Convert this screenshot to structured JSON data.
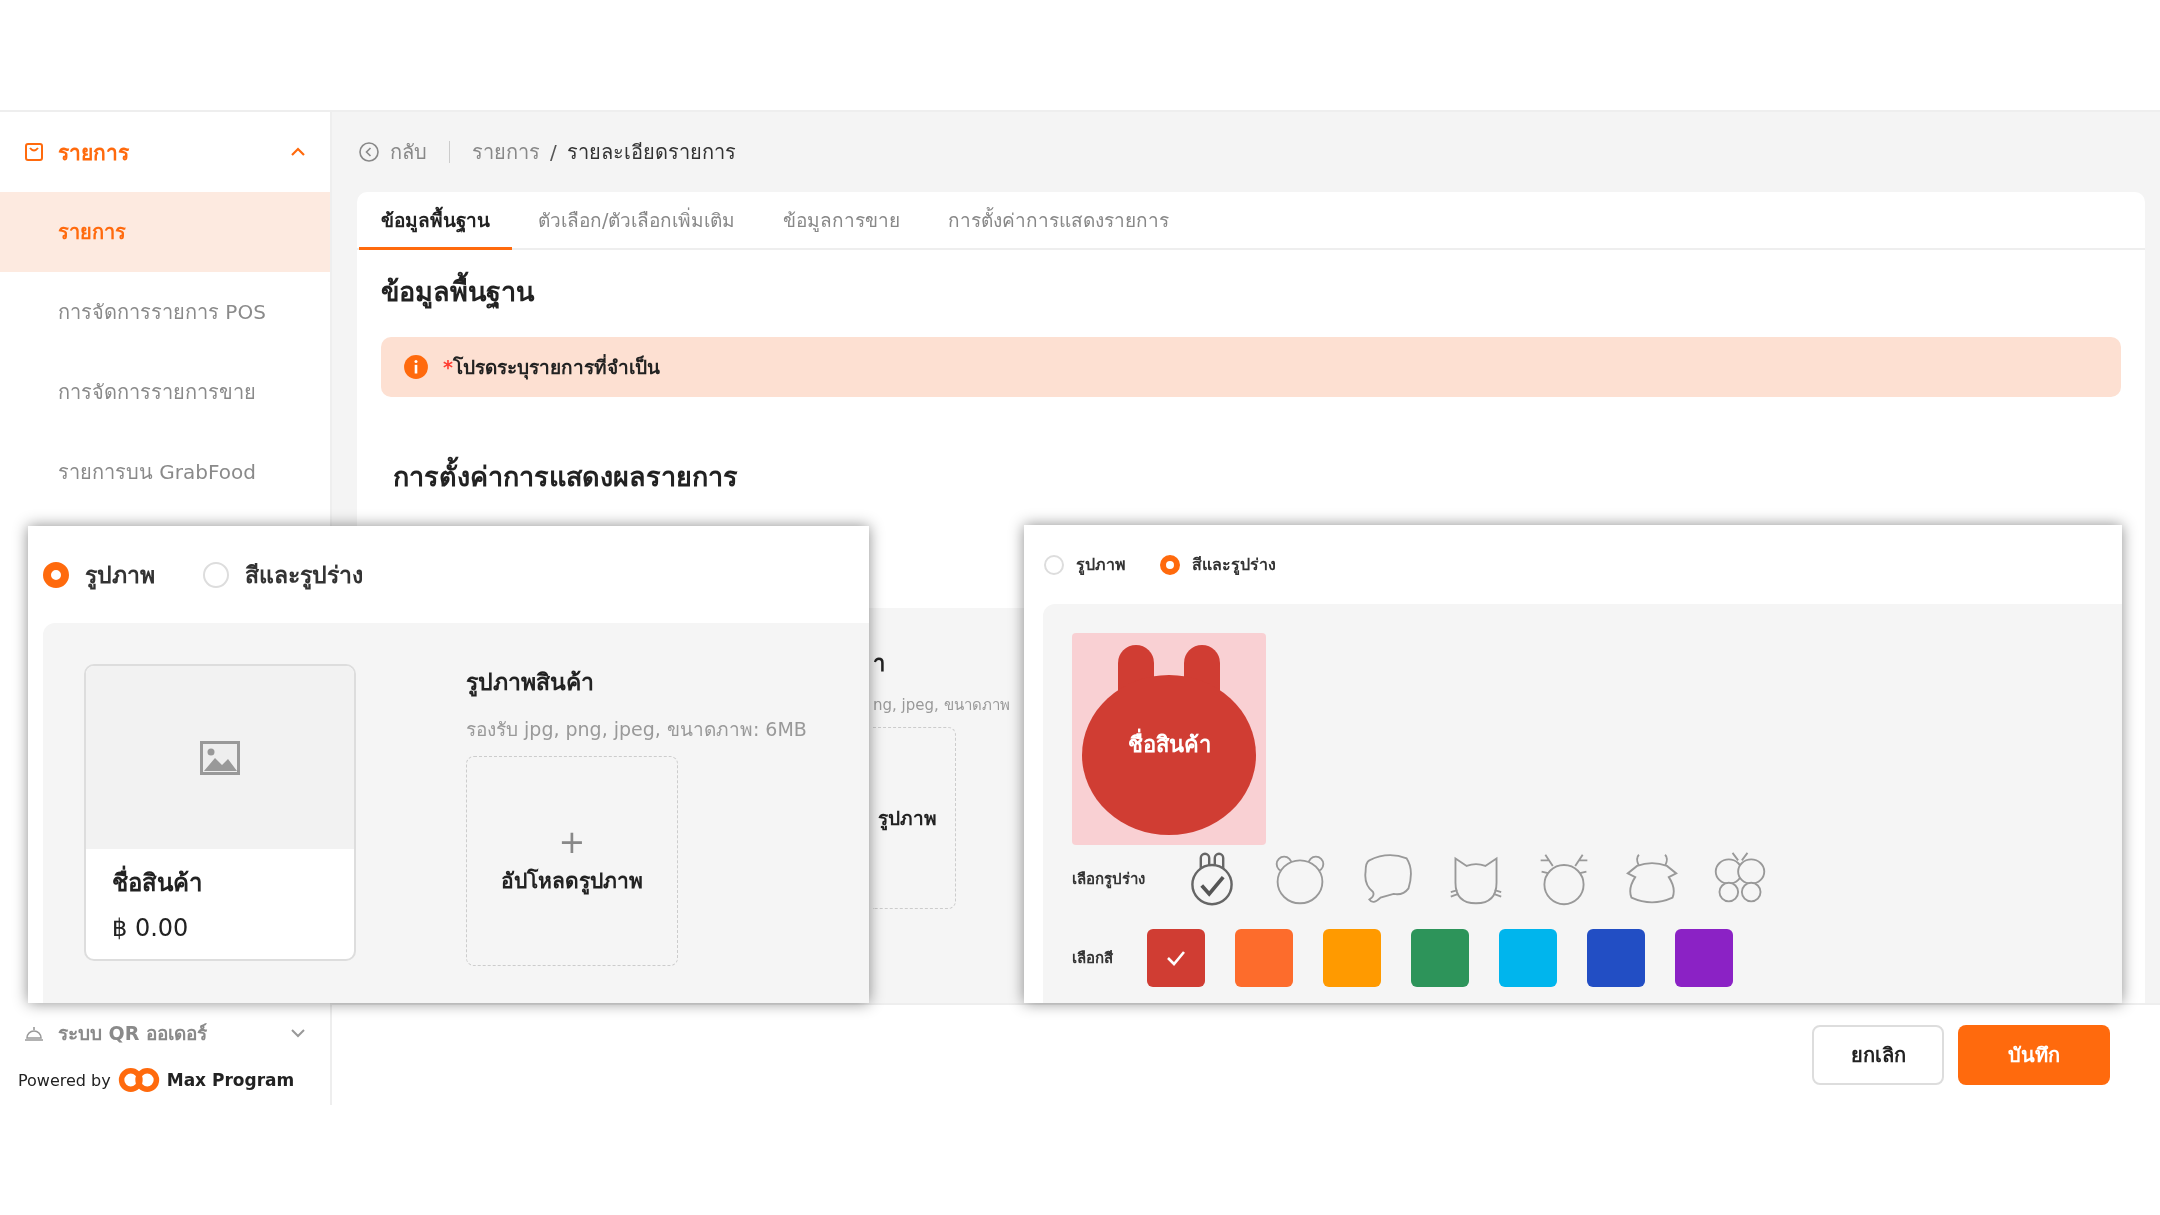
{
  "sidebar": {
    "section": {
      "label": "รายการ",
      "expanded": true
    },
    "items": [
      {
        "label": "รายการ",
        "selected": true
      },
      {
        "label": "การจัดการรายการ POS",
        "selected": false
      },
      {
        "label": "การจัดการรายการขาย",
        "selected": false
      },
      {
        "label": "รายการบน GrabFood",
        "selected": false
      }
    ],
    "footer_section": {
      "label": "ระบบ QR ออเดอร์",
      "expanded": false
    },
    "powered_by": {
      "prefix": "Powered by",
      "brand": "Max Program"
    }
  },
  "breadcrumb": {
    "back": "กลับ",
    "separator": "/",
    "items": [
      "รายการ",
      "รายละเอียดรายการ"
    ]
  },
  "tabs": [
    {
      "label": "ข้อมูลพื้นฐาน",
      "selected": true
    },
    {
      "label": "ตัวเลือก/ตัวเลือกเพิ่มเติม",
      "selected": false
    },
    {
      "label": "ข้อมูลการขาย",
      "selected": false
    },
    {
      "label": "การตั้งค่าการแสดงรายการ",
      "selected": false
    }
  ],
  "section_title": "ข้อมูลพื้นฐาน",
  "alert": {
    "mark": "*",
    "text": "โปรดระบุรายการที่จำเป็น"
  },
  "display_settings": {
    "title": "การตั้งค่าการแสดงผลรายการ",
    "fragments": {
      "heading": "า",
      "hint": "ng, jpeg, ขนาดภาพ",
      "upload_label": "รูปภาพ"
    }
  },
  "image_panel": {
    "options": [
      {
        "label": "รูปภาพ",
        "selected": true
      },
      {
        "label": "สีและรูปร่าง",
        "selected": false
      }
    ],
    "card": {
      "name": "ชื่อสินค้า",
      "price": "฿ 0.00"
    },
    "upload": {
      "title": "รูปภาพสินค้า",
      "hint": "รองรับ jpg, png, jpeg, ขนาดภาพ: 6MB",
      "plus": "+",
      "button": "อัปโหลดรูปภาพ"
    }
  },
  "shape_panel": {
    "options": [
      {
        "label": "รูปภาพ",
        "selected": false
      },
      {
        "label": "สีและรูปร่าง",
        "selected": true
      }
    ],
    "preview": {
      "label": "ชื่อสินค้า"
    },
    "shape_label": "เลือกรูปร่าง",
    "shapes": [
      {
        "kind": "bunny",
        "selected": true
      },
      {
        "kind": "bear",
        "selected": false
      },
      {
        "kind": "elephant",
        "selected": false
      },
      {
        "kind": "cat",
        "selected": false
      },
      {
        "kind": "deer",
        "selected": false
      },
      {
        "kind": "cow",
        "selected": false
      },
      {
        "kind": "butterfly",
        "selected": false
      }
    ],
    "color_label": "เลือกสี",
    "colors": [
      {
        "color": "#d03d33",
        "selected": true
      },
      {
        "color": "#fd6c2c",
        "selected": false
      },
      {
        "color": "#ff9a00",
        "selected": false
      },
      {
        "color": "#2d945a",
        "selected": false
      },
      {
        "color": "#00b5ed",
        "selected": false
      },
      {
        "color": "#224ec4",
        "selected": false
      },
      {
        "color": "#8b22c5",
        "selected": false
      }
    ]
  },
  "actions": [
    {
      "label": "ยกเลิก",
      "kind": "secondary"
    },
    {
      "label": "บันทึก",
      "kind": "primary"
    }
  ]
}
